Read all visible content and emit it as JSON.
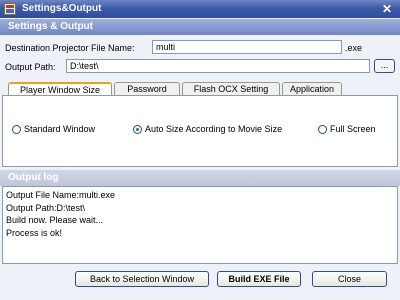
{
  "window": {
    "title": "Settings&Output",
    "close_symbol": "✕"
  },
  "settings": {
    "header": "Settings & Output",
    "projector_label": "Destination Projector File Name:",
    "projector_value": "multi",
    "extension": ".exe",
    "output_label": "Output Path:",
    "output_value": "D:\\test\\",
    "browse_label": "..."
  },
  "tabs": [
    {
      "label": "Player Window Size",
      "active": true
    },
    {
      "label": "Password"
    },
    {
      "label": "Flash OCX Setting"
    },
    {
      "label": "Application"
    }
  ],
  "window_size_options": [
    {
      "label": "Standard Window",
      "selected": false
    },
    {
      "label": "Auto Size According to Movie Size",
      "selected": true
    },
    {
      "label": "Full Screen",
      "selected": false
    }
  ],
  "output_log": {
    "header": "Output log",
    "lines": [
      "Output File Name:multi.exe",
      "Output Path:D:\\test\\",
      "Build now. Please wait...",
      "Process is ok!"
    ]
  },
  "buttons": {
    "back": "Back to Selection Window",
    "build": "Build EXE File",
    "close": "Close"
  }
}
